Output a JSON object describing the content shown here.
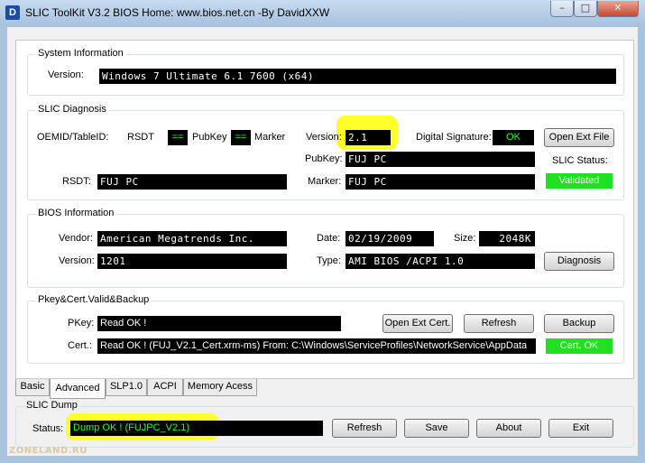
{
  "window": {
    "title": "SLIC ToolKit V3.2     BIOS Home: www.bios.net.cn  -By DavidXXW",
    "icon_letter": "D",
    "minimize_glyph": "–",
    "maximize_glyph": "□",
    "close_glyph": "✕"
  },
  "system_info": {
    "title": "System Information",
    "version_label": "Version:",
    "version_value": "Windows 7 Ultimate 6.1 7600    (x64)"
  },
  "slic_diag": {
    "title": "SLIC Diagnosis",
    "oemid_label": "OEMID/TableID:",
    "rsdt_text": "RSDT",
    "eq1": "==",
    "pubkey_text": "PubKey",
    "eq2": "==",
    "marker_text": "Marker",
    "version_label": "Version:",
    "version_value": "2.1",
    "digsig_label": "Digital Signature:",
    "digsig_value": "OK",
    "open_ext_file": "Open Ext File",
    "pubkey_label": "PubKey:",
    "pubkey_value": "FUJ   PC",
    "slic_status_label": "SLIC Status:",
    "rsdt_label": "RSDT:",
    "rsdt_value": "FUJ   PC",
    "marker_label": "Marker:",
    "marker_value": "FUJ   PC",
    "slic_status_value": "Validated"
  },
  "bios_info": {
    "title": "BIOS Information",
    "vendor_label": "Vendor:",
    "vendor_value": "American Megatrends Inc.",
    "date_label": "Date:",
    "date_value": "02/19/2009",
    "size_label": "Size:",
    "size_value": "2048K",
    "version_label": "Version:",
    "version_value": "1201",
    "type_label": "Type:",
    "type_value": "AMI BIOS /ACPI 1.0",
    "diagnosis": "Diagnosis"
  },
  "pkey": {
    "title": "Pkey&Cert.Valid&Backup",
    "pkey_label": "PKey:",
    "pkey_value": "Read OK !",
    "open_ext_cert": "Open Ext Cert.",
    "refresh": "Refresh",
    "backup": "Backup",
    "cert_label": "Cert.:",
    "cert_value": "Read OK ! (FUJ_V2.1_Cert.xrm-ms)    From: C:\\Windows\\ServiceProfiles\\NetworkService\\AppData",
    "cert_status": "Cert. OK"
  },
  "tabs": [
    "Basic",
    "Advanced",
    "SLP1.0",
    "ACPI",
    "Memory Acess"
  ],
  "slic_dump": {
    "title": "SLIC Dump",
    "status_label": "Status:",
    "status_value": "Dump OK ! (FUJPC_V2.1)",
    "refresh": "Refresh",
    "save": "Save",
    "about": "About",
    "exit": "Exit"
  },
  "watermark": "ZONELAND.RU",
  "colors": {
    "field_bg": "#000000",
    "status_ok": "#20e020",
    "highlight": "#ffff2a"
  }
}
